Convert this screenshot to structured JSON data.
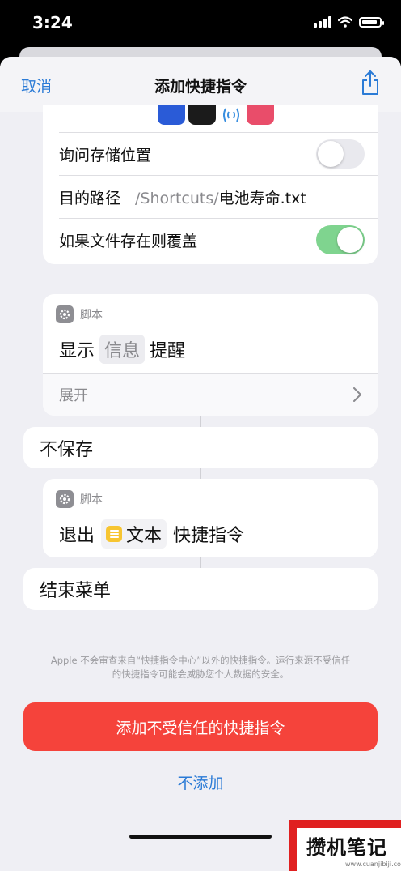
{
  "status": {
    "time": "3:24"
  },
  "nav": {
    "cancel": "取消",
    "title": "添加快捷指令"
  },
  "save_card": {
    "ask_location": "询问存储位置",
    "dest_label": "目的路径",
    "dest_path": "/Shortcuts/",
    "dest_file": "电池寿命.txt",
    "overwrite": "如果文件存在则覆盖",
    "ask_location_on": false,
    "overwrite_on": true
  },
  "alert_card": {
    "category": "脚本",
    "prefix": "显示",
    "variable": "信息",
    "suffix": "提醒",
    "expand": "展开"
  },
  "menu_item_no_save": "不保存",
  "exit_card": {
    "category": "脚本",
    "prefix": "退出",
    "variable": "文本",
    "suffix": "快捷指令"
  },
  "end_menu": "结束菜单",
  "footnote_line1": "Apple 不会审查来自“快捷指令中心”以外的快捷指令。运行来源不受信任",
  "footnote_line2": "的快捷指令可能会威胁您个人数据的安全。",
  "buttons": {
    "add_untrusted": "添加不受信任的快捷指令",
    "dont_add": "不添加"
  },
  "watermark": {
    "text": "攒机笔记",
    "url": "www.cuanjibiji.com"
  },
  "colors": {
    "accent": "#2b7bd6",
    "danger": "#f5433b",
    "toggle_on": "#7fd48f"
  }
}
